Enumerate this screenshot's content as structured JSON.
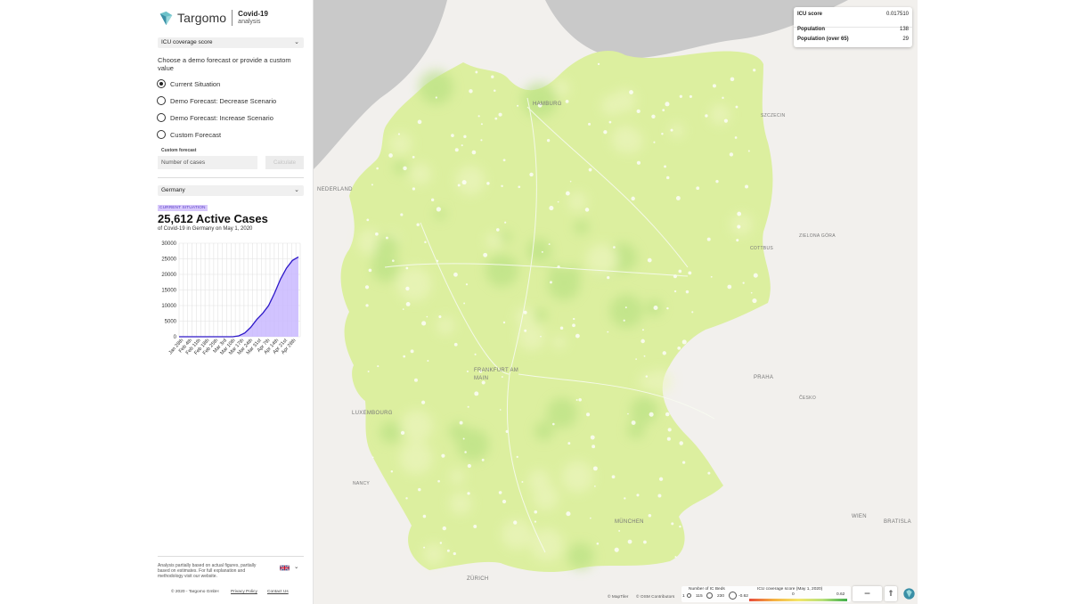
{
  "app": {
    "brand": "Targomo",
    "title_line1": "Covid-19",
    "title_line2": "analysis"
  },
  "sidebar": {
    "metric_select": "ICU coverage score",
    "choose_text": "Choose a demo forecast or provide a custom value",
    "radio_options": [
      {
        "label": "Current Situation",
        "checked": true
      },
      {
        "label": "Demo Forecast: Decrease Scenario",
        "checked": false
      },
      {
        "label": "Demo Forecast: Increase Scenario",
        "checked": false
      },
      {
        "label": "Custom Forecast",
        "checked": false
      }
    ],
    "custom_forecast_label": "Custom forecast",
    "custom_forecast_placeholder": "Number of cases",
    "calculate_label": "Calculate",
    "region_select": "Germany",
    "badge": "CURRENT SITUATION",
    "headline": "25,612 Active Cases",
    "subline": "of Covid-19 in Germany on May 1, 2020",
    "footnote": "Analysis partially based on actual figures, partially based on estimates. For full explanation and methodology visit our website.",
    "footer": {
      "copyright": "© 2020 - Targomo GmbH",
      "privacy": "Privacy Policy",
      "contact": "Contact Us"
    },
    "language_flag": "uk-flag-icon"
  },
  "chart_data": {
    "type": "area",
    "title": "",
    "xlabel": "",
    "ylabel": "",
    "ylim": [
      0,
      30000
    ],
    "yticks": [
      0,
      5000,
      10000,
      15000,
      20000,
      25000,
      30000
    ],
    "categories": [
      "Jan 28th",
      "Feb 4th",
      "Feb 11th",
      "Feb 18th",
      "Feb 25th",
      "Mar 3rd",
      "Mar 10th",
      "Mar 17th",
      "Mar 24th",
      "Mar 31st",
      "Apr 7th",
      "Apr 14th",
      "Apr 21st",
      "Apr 28th"
    ],
    "series": [
      {
        "values": [
          0,
          0,
          0,
          0,
          0,
          0,
          0,
          0,
          0,
          0,
          300,
          1200,
          3000,
          5500,
          7500,
          10000,
          14000,
          18500,
          22000,
          24500,
          25612
        ]
      }
    ],
    "colors": {
      "line": "#2d18c8",
      "fill": "#c9b9ff"
    },
    "grid": true
  },
  "map": {
    "info_panel": {
      "icu_score_label": "ICU score",
      "icu_score_value": "0.017510",
      "population_label": "Population",
      "population_value": "138",
      "population_65_label": "Population (over 65)",
      "population_65_value": "29"
    },
    "cities": [
      "HAMBURG",
      "FRANKFURT AM MAIN",
      "MÜNCHEN",
      "PRAHA",
      "LUXEMBOURG",
      "WIEN",
      "ZÜRICH",
      "SZCZECIN",
      "COTTBUS",
      "ZIELONA GÓRA",
      "ČESKO",
      "BRATISLA",
      "NANCY",
      "NEDERLAND"
    ],
    "attribution_maptiler": "© MapTiler",
    "attribution_osm": "© OSM Contributors",
    "legend": {
      "beds_title": "Number of IC Beds",
      "beds_values": [
        "1",
        "115",
        "230"
      ],
      "score_title": "ICU coverage score (May 1, 2020)",
      "score_min": "-0.62",
      "score_mid": "0",
      "score_max": "0.62"
    },
    "controls": {
      "zoom_out": "−",
      "zoom_in": "+"
    },
    "colors": {
      "land": "#dbeeaa",
      "water": "#c7c7c7",
      "background": "#f3f1ee",
      "accent": "#9bd56a"
    }
  }
}
